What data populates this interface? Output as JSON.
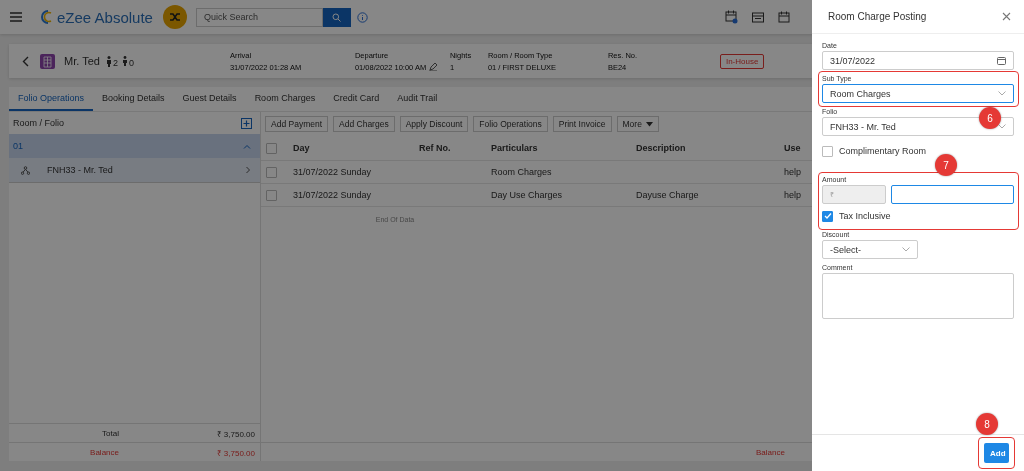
{
  "header": {
    "logo_text": "eZee Absolute",
    "search": {
      "placeholder": "Quick Search"
    }
  },
  "reservation": {
    "guest": "Mr. Ted",
    "adults": "2",
    "children": "0",
    "fields": [
      {
        "label": "Arrival",
        "value": "31/07/2022 01:28 AM",
        "editable": false
      },
      {
        "label": "Departure",
        "value": "01/08/2022 10:00 AM",
        "editable": true
      },
      {
        "label": "Nights",
        "value": "1",
        "editable": false
      },
      {
        "label": "Room / Room Type",
        "value": "01 / FIRST DELUXE",
        "editable": false
      },
      {
        "label": "Res. No.",
        "value": "BE24",
        "editable": false
      }
    ],
    "status": "In-House"
  },
  "tabs": [
    {
      "label": "Folio Operations",
      "selected": true
    },
    {
      "label": "Booking Details",
      "selected": false
    },
    {
      "label": "Guest Details",
      "selected": false
    },
    {
      "label": "Room Charges",
      "selected": false
    },
    {
      "label": "Credit Card",
      "selected": false
    },
    {
      "label": "Audit Trail",
      "selected": false
    }
  ],
  "folio_panel": {
    "title": "Room / Folio",
    "rooms": [
      {
        "label": "01",
        "expanded": true,
        "children": [
          {
            "label": "FNH33 - Mr. Ted"
          }
        ]
      }
    ],
    "totals": [
      {
        "label": "Total",
        "value": "₹ 3,750.00",
        "kind": "total"
      },
      {
        "label": "Balance",
        "value": "₹ 3,750.00",
        "kind": "balance"
      }
    ]
  },
  "toolbar": [
    {
      "label": "Add Payment",
      "kind": "button"
    },
    {
      "label": "Add Charges",
      "kind": "button"
    },
    {
      "label": "Apply Discount",
      "kind": "button"
    },
    {
      "label": "Folio Operations",
      "kind": "button"
    },
    {
      "label": "Print Invoice",
      "kind": "button"
    },
    {
      "label": "More",
      "kind": "dropdown"
    }
  ],
  "table": {
    "columns": [
      "Day",
      "Ref No.",
      "Particulars",
      "Description",
      "Use"
    ],
    "rows": [
      {
        "cells": [
          "31/07/2022 Sunday",
          "",
          "Room Charges",
          "",
          "help"
        ],
        "checked": false
      },
      {
        "cells": [
          "31/07/2022 Sunday",
          "",
          "Day Use Charges",
          "Dayuse Charge",
          "help"
        ],
        "checked": false
      }
    ],
    "all_checked": false,
    "end_text": "End Of Data",
    "footer": "Balance"
  },
  "drawer": {
    "title": "Room Charge Posting",
    "fields": [
      {
        "kind": "date",
        "label": "Date",
        "value": "31/07/2022",
        "focused": false
      },
      {
        "kind": "select",
        "label": "Sub Type",
        "value": "Room Charges",
        "focused": true,
        "callout": "6"
      },
      {
        "kind": "select",
        "label": "Folio",
        "value": "FNH33 - Mr. Ted",
        "focused": false
      },
      {
        "kind": "checkbox",
        "label": "Complimentary Room",
        "checked": false
      },
      {
        "kind": "amount",
        "label": "Amount",
        "currency": "₹",
        "focused": true,
        "callout": "7",
        "tax_inclusive": {
          "label": "Tax Inclusive",
          "checked": true
        }
      },
      {
        "kind": "small-select",
        "label": "Discount",
        "value": "-Select-",
        "focused": false
      },
      {
        "kind": "textarea",
        "label": "Comment",
        "focused": false
      }
    ],
    "button": {
      "label": "Add",
      "callout": "8"
    }
  }
}
